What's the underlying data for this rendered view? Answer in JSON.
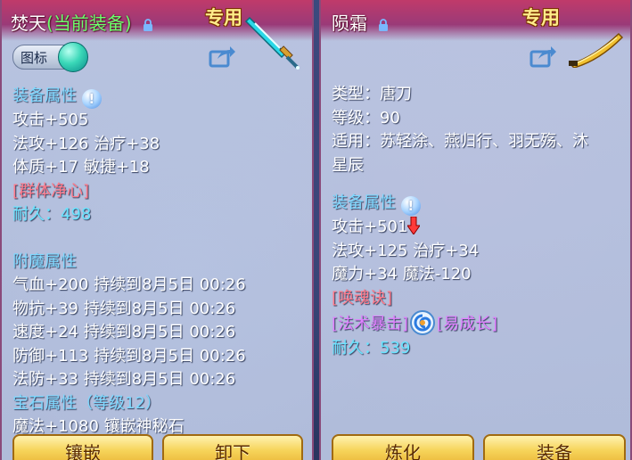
{
  "left_item": {
    "name": "焚天",
    "equipped_tag": "(当前装备)",
    "exclusive_label": "专用",
    "icon_toggle_label": "图标",
    "equip_attr_title": "装备属性",
    "stats": [
      "攻击+505",
      "法攻+126 治疗+38",
      "体质+17 敏捷+18"
    ],
    "special": "[群体净心]",
    "durability": "耐久：498",
    "enchant_title": "附魔属性",
    "enchants": [
      "气血+200 持续到8月5日 00:26",
      "物抗+39 持续到8月5日 00:26",
      "速度+24 持续到8月5日 00:26",
      "防御+113 持续到8月5日 00:26",
      "法防+33 持续到8月5日 00:26"
    ],
    "gem_title": "宝石属性（等级12）",
    "gem_line": "魔法+1080 镶嵌神秘石",
    "buttons": [
      "镶嵌",
      "卸下"
    ]
  },
  "right_item": {
    "name": "陨霜",
    "exclusive_label": "专用",
    "type": "类型：唐刀",
    "level": "等级：90",
    "applicable_1": "适用：苏轻涂、燕归行、羽无殇、沐",
    "applicable_2": "星辰",
    "equip_attr_title": "装备属性",
    "attack": "攻击+501",
    "stats": [
      "法攻+125 治疗+34",
      "魔力+34 魔法-120"
    ],
    "special": "[唤魂诀]",
    "skill_1": "[法术暴击]",
    "skill_2": "[易成长]",
    "durability": "耐久：539",
    "buttons": [
      "炼化",
      "装备"
    ]
  }
}
